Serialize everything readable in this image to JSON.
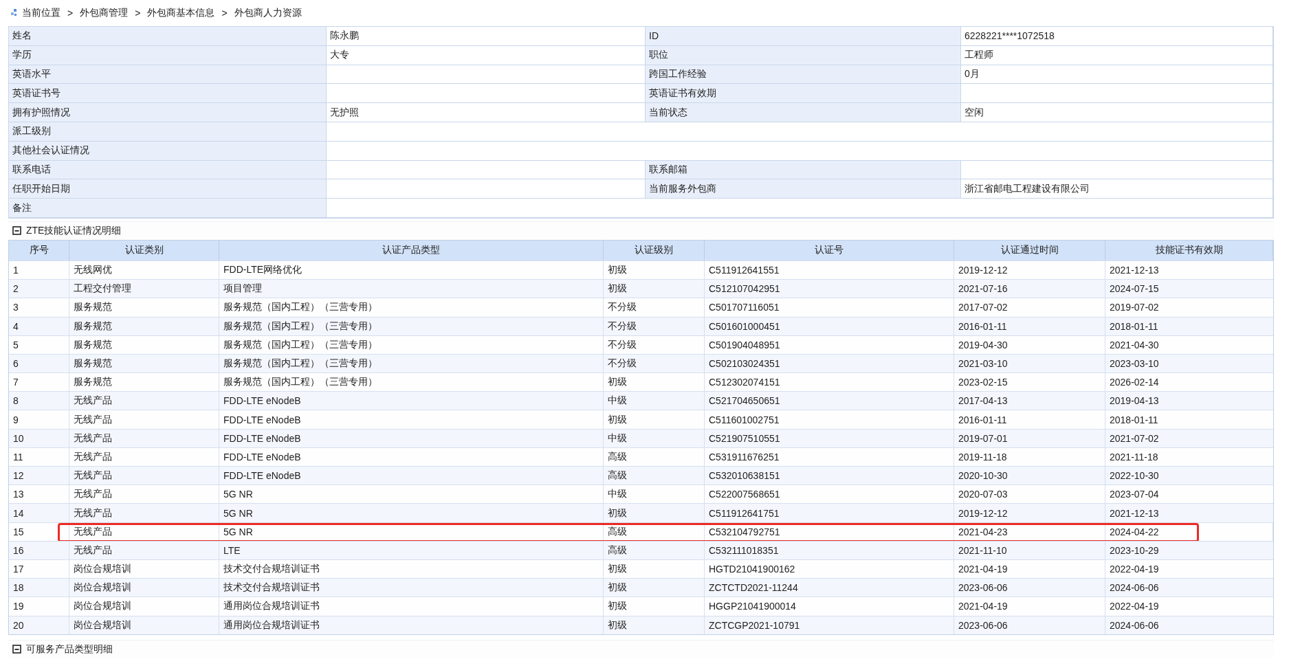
{
  "breadcrumb": [
    {
      "label": "当前位置"
    },
    {
      "separator": ">",
      "label": "外包商管理"
    },
    {
      "separator": ">",
      "label": "外包商基本信息"
    },
    {
      "separator": ">",
      "label": "外包商人力资源"
    }
  ],
  "info": [
    {
      "fields": [
        {
          "label": "姓名",
          "value": "陈永鹏"
        },
        {
          "label": "ID",
          "value": "6228221****1072518"
        }
      ]
    },
    {
      "fields": [
        {
          "label": "学历",
          "value": "大专"
        },
        {
          "label": "职位",
          "value": "工程师"
        }
      ]
    },
    {
      "fields": [
        {
          "label": "英语水平"
        },
        {
          "label": "跨国工作经验",
          "value": "0月"
        }
      ]
    },
    {
      "fields": [
        {
          "label": "英语证书号"
        },
        {
          "label": "英语证书有效期"
        }
      ]
    },
    {
      "fields": [
        {
          "label": "拥有护照情况",
          "value": "无护照"
        },
        {
          "label": "当前状态",
          "value": "空闲"
        }
      ]
    },
    {
      "fields": [
        {
          "label": "派工级别"
        }
      ]
    },
    {
      "fields": [
        {
          "label": "其他社会认证情况"
        }
      ]
    },
    {
      "fields": [
        {
          "label": "联系电话"
        },
        {
          "label": "联系邮箱"
        }
      ]
    },
    {
      "fields": [
        {
          "label": "任职开始日期"
        },
        {
          "label": "当前服务外包商",
          "value": "浙江省邮电工程建设有限公司"
        }
      ]
    },
    {
      "fields": [
        {
          "label": "备注"
        }
      ]
    }
  ],
  "certifications": {
    "title": "ZTE技能认证情况明细",
    "expanded": true,
    "columns": [
      "序号",
      "认证类别",
      "认证产品类型",
      "认证级别",
      "认证号",
      "认证通过时间",
      "技能证书有效期"
    ],
    "rows": [
      {
        "cells": [
          "1",
          "无线网优",
          "FDD-LTE网络优化",
          "初级",
          "C511912641551",
          "2019-12-12",
          "2021-12-13"
        ],
        "highlighted": false
      },
      {
        "cells": [
          "2",
          "工程交付管理",
          "项目管理",
          "初级",
          "C512107042951",
          "2021-07-16",
          "2024-07-15"
        ],
        "highlighted": false
      },
      {
        "cells": [
          "3",
          "服务规范",
          "服务规范（国内工程）（三营专用）",
          "不分级",
          "C501707116051",
          "2017-07-02",
          "2019-07-02"
        ],
        "highlighted": false
      },
      {
        "cells": [
          "4",
          "服务规范",
          "服务规范（国内工程）（三营专用）",
          "不分级",
          "C501601000451",
          "2016-01-11",
          "2018-01-11"
        ],
        "highlighted": false
      },
      {
        "cells": [
          "5",
          "服务规范",
          "服务规范（国内工程）（三营专用）",
          "不分级",
          "C501904048951",
          "2019-04-30",
          "2021-04-30"
        ],
        "highlighted": false
      },
      {
        "cells": [
          "6",
          "服务规范",
          "服务规范（国内工程）（三营专用）",
          "不分级",
          "C502103024351",
          "2021-03-10",
          "2023-03-10"
        ],
        "highlighted": false
      },
      {
        "cells": [
          "7",
          "服务规范",
          "服务规范（国内工程）（三营专用）",
          "初级",
          "C512302074151",
          "2023-02-15",
          "2026-02-14"
        ],
        "highlighted": false
      },
      {
        "cells": [
          "8",
          "无线产品",
          "FDD-LTE eNodeB",
          "中级",
          "C521704650651",
          "2017-04-13",
          "2019-04-13"
        ],
        "highlighted": false
      },
      {
        "cells": [
          "9",
          "无线产品",
          "FDD-LTE eNodeB",
          "初级",
          "C511601002751",
          "2016-01-11",
          "2018-01-11"
        ],
        "highlighted": false
      },
      {
        "cells": [
          "10",
          "无线产品",
          "FDD-LTE eNodeB",
          "中级",
          "C521907510551",
          "2019-07-01",
          "2021-07-02"
        ],
        "highlighted": false
      },
      {
        "cells": [
          "11",
          "无线产品",
          "FDD-LTE eNodeB",
          "高级",
          "C531911676251",
          "2019-11-18",
          "2021-11-18"
        ],
        "highlighted": false
      },
      {
        "cells": [
          "12",
          "无线产品",
          "FDD-LTE eNodeB",
          "高级",
          "C532010638151",
          "2020-10-30",
          "2022-10-30"
        ],
        "highlighted": false
      },
      {
        "cells": [
          "13",
          "无线产品",
          "5G NR",
          "中级",
          "C522007568651",
          "2020-07-03",
          "2023-07-04"
        ],
        "highlighted": false
      },
      {
        "cells": [
          "14",
          "无线产品",
          "5G NR",
          "初级",
          "C511912641751",
          "2019-12-12",
          "2021-12-13"
        ],
        "highlighted": false
      },
      {
        "cells": [
          "15",
          "无线产品",
          "5G NR",
          "高级",
          "C532104792751",
          "2021-04-23",
          "2024-04-22"
        ],
        "highlighted": true
      },
      {
        "cells": [
          "16",
          "无线产品",
          "LTE",
          "高级",
          "C532111018351",
          "2021-11-10",
          "2023-10-29"
        ],
        "highlighted": false
      },
      {
        "cells": [
          "17",
          "岗位合规培训",
          "技术交付合规培训证书",
          "初级",
          "HGTD21041900162",
          "2021-04-19",
          "2022-04-19"
        ],
        "highlighted": false
      },
      {
        "cells": [
          "18",
          "岗位合规培训",
          "技术交付合规培训证书",
          "初级",
          "ZCTCTD2021-11244",
          "2023-06-06",
          "2024-06-06"
        ],
        "highlighted": false
      },
      {
        "cells": [
          "19",
          "岗位合规培训",
          "通用岗位合规培训证书",
          "初级",
          "HGGP21041900014",
          "2021-04-19",
          "2022-04-19"
        ],
        "highlighted": false
      },
      {
        "cells": [
          "20",
          "岗位合规培训",
          "通用岗位合规培训证书",
          "初级",
          "ZCTCGP2021-10791",
          "2023-06-06",
          "2024-06-06"
        ],
        "highlighted": false
      }
    ]
  },
  "products": {
    "title": "可服务产品类型明细",
    "expanded": true
  }
}
